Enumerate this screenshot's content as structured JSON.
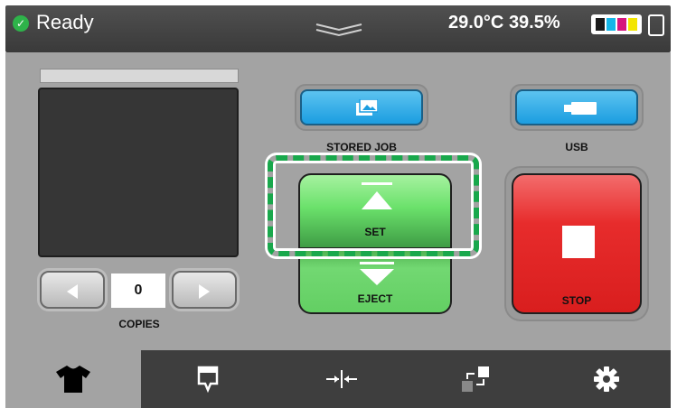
{
  "status": {
    "state_text": "Ready",
    "check_icon": "check-circle-icon",
    "temperature": "29.0°C",
    "humidity": "39.5%",
    "ink_colors": [
      "#1a1a1a",
      "#15b6e8",
      "#d6157d",
      "#f3e500"
    ]
  },
  "preview": {
    "copies_value": "0",
    "copies_label": "COPIES"
  },
  "buttons": {
    "stored_job_label": "STORED JOB",
    "usb_label": "USB",
    "set_label": "SET",
    "eject_label": "EJECT",
    "stop_label": "STOP"
  },
  "tabs": [
    {
      "name": "shirt-icon",
      "active": true
    },
    {
      "name": "comment-icon",
      "active": false
    },
    {
      "name": "align-center-icon",
      "active": false
    },
    {
      "name": "transfer-icon",
      "active": false
    },
    {
      "name": "gear-icon",
      "active": false
    }
  ],
  "colors": {
    "accent_green": "#19a84c",
    "stop_red": "#e72c2c",
    "blue": "#1b9de0"
  }
}
